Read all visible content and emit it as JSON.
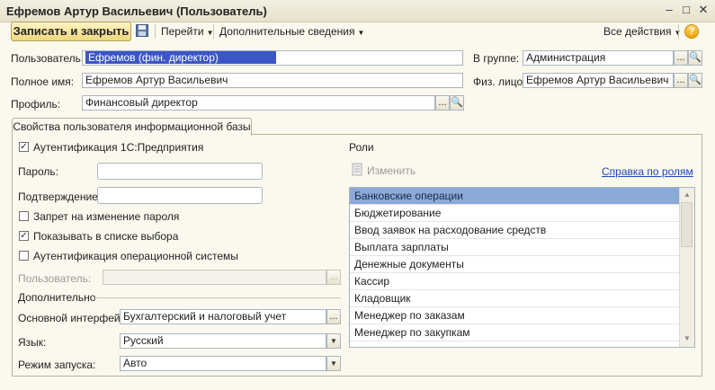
{
  "window": {
    "title": "Ефремов Артур Васильевич (Пользователь)"
  },
  "toolbar": {
    "save_close": "Записать и закрыть",
    "goto": "Перейти",
    "extra_info": "Дополнительные сведения",
    "all_actions": "Все действия",
    "help": "?"
  },
  "form": {
    "user_label": "Пользователь:",
    "user_value": "Ефремов (фин. директор)",
    "fullname_label": "Полное имя:",
    "fullname_value": "Ефремов Артур Васильевич",
    "profile_label": "Профиль:",
    "profile_value": "Финансовый директор",
    "group_label": "В группе:",
    "group_value": "Администрация",
    "person_label": "Физ. лицо:",
    "person_value": "Ефремов Артур Васильевич"
  },
  "tab": {
    "label": "Свойства пользователя информационной базы"
  },
  "auth": {
    "auth_1c_label": "Аутентификация 1С:Предприятия",
    "auth_1c_checked": true,
    "password_label": "Пароль:",
    "password_value": "",
    "confirm_label": "Подтверждение:",
    "confirm_value": "",
    "deny_change_label": "Запрет на изменение пароля",
    "deny_change_checked": false,
    "show_in_list_label": "Показывать в списке выбора",
    "show_in_list_checked": true,
    "os_auth_label": "Аутентификация операционной системы",
    "os_auth_checked": false,
    "os_user_label": "Пользователь:",
    "os_user_value": ""
  },
  "additional": {
    "section_label": "Дополнительно",
    "interface_label": "Основной интерфейс:",
    "interface_value": "Бухгалтерский и налоговый учет",
    "language_label": "Язык:",
    "language_value": "Русский",
    "startup_label": "Режим запуска:",
    "startup_value": "Авто"
  },
  "roles": {
    "section_label": "Роли",
    "edit_label": "Изменить",
    "help_link": "Справка по ролям",
    "items": [
      "Банковские операции",
      "Бюджетирование",
      "Ввод заявок на расходование средств",
      "Выплата зарплаты",
      "Денежные документы",
      "Кассир",
      "Кладовщик",
      "Менеджер по заказам",
      "Менеджер по закупкам"
    ],
    "selected_index": 0
  },
  "icons": [
    "minimize-icon",
    "restore-icon",
    "close-icon",
    "save-disk-icon",
    "help-icon",
    "select-ellipsis-icon",
    "open-magnifier-icon",
    "dropdown-arrow-icon",
    "checkbox-check-icon",
    "edit-roles-icon",
    "scroll-up-icon",
    "scroll-down-icon"
  ]
}
